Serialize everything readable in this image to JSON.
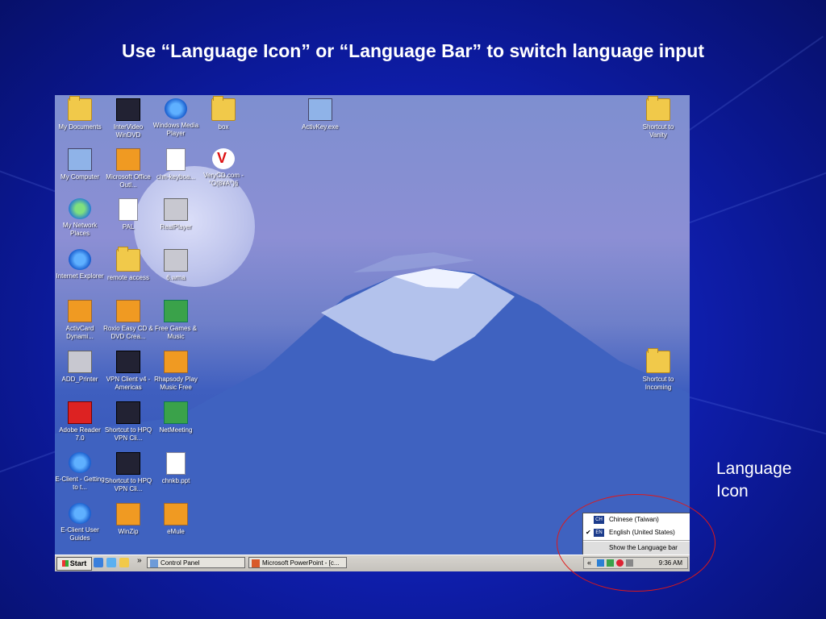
{
  "slide": {
    "title": "Use “Language Icon” or “Language Bar” to switch language input",
    "annotation_line1": "Language",
    "annotation_line2": "Icon"
  },
  "desktop_icons": [
    {
      "label": "My Documents"
    },
    {
      "label": "InterVideo WinDVD"
    },
    {
      "label": "Windows Media Player"
    },
    {
      "label": "box"
    },
    {
      "label": "ActivKey.exe"
    },
    {
      "label": "Shortcut to Vanity"
    },
    {
      "label": "My Computer"
    },
    {
      "label": "Microsoft Office Outl..."
    },
    {
      "label": "chn-keyboa..."
    },
    {
      "label": "VeryCD.com - °Ο(8¥Α°)§"
    },
    {
      "label": "My Network Places"
    },
    {
      "label": "PAL"
    },
    {
      "label": "RealPlayer"
    },
    {
      "label": "Internet Explorer"
    },
    {
      "label": "remote access"
    },
    {
      "label": "6.wma"
    },
    {
      "label": "ActivCard Dynami..."
    },
    {
      "label": "Roxio Easy CD & DVD Crea..."
    },
    {
      "label": "Free Games & Music"
    },
    {
      "label": "ADD_Printer"
    },
    {
      "label": "VPN Client v4 - Americas"
    },
    {
      "label": "Rhapsody Play Music Free"
    },
    {
      "label": "Shortcut to Incoming"
    },
    {
      "label": "Adobe Reader 7.0"
    },
    {
      "label": "Shortcut to HPQ VPN Cli..."
    },
    {
      "label": "NetMeeting"
    },
    {
      "label": "E-Client - Getting to t..."
    },
    {
      "label": "Shortcut to HPQ VPN Cli..."
    },
    {
      "label": "chnkb.ppt"
    },
    {
      "label": "E-Client User Guides"
    },
    {
      "label": "WinZip"
    },
    {
      "label": "eMule"
    }
  ],
  "taskbar": {
    "start_label": "Start",
    "chevron": "»",
    "tasks": [
      "Control Panel",
      "Microsoft PowerPoint - [c..."
    ],
    "language_indicator": "EN",
    "tray_chevron": "«",
    "clock": "9:36 AM"
  },
  "language_menu": {
    "items": [
      {
        "code": "CH",
        "label": "Chinese (Taiwan)",
        "checked": false
      },
      {
        "code": "EN",
        "label": "English (United States)",
        "checked": true
      }
    ],
    "check_mark": "✔",
    "show_bar_label": "Show the Language bar"
  },
  "colors": {
    "slide_background": "#0f1fb0",
    "highlight_ellipse": "#e01818",
    "language_badge": "#1c3c8c"
  }
}
